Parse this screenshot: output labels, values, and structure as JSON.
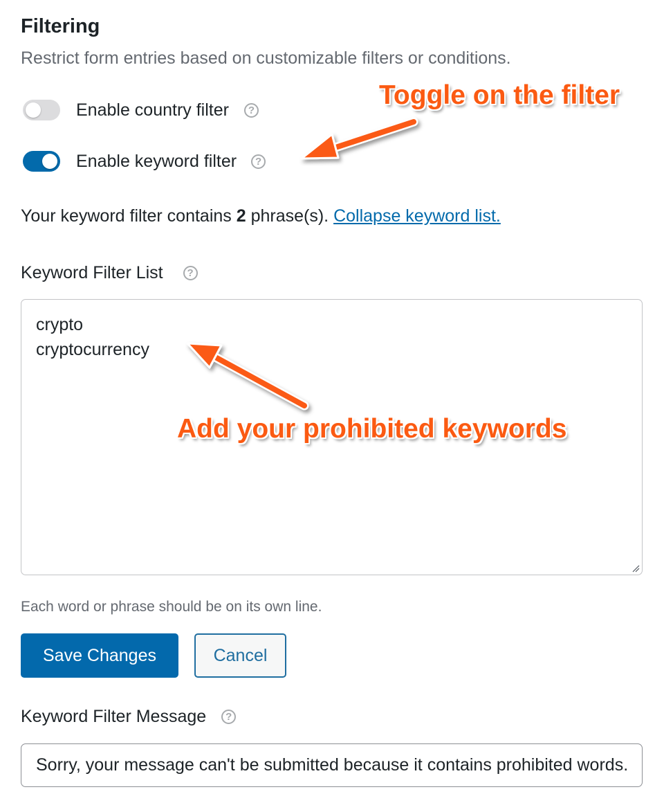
{
  "section": {
    "title": "Filtering",
    "description": "Restrict form entries based on customizable filters or conditions."
  },
  "toggles": [
    {
      "label": "Enable country filter",
      "enabled": false
    },
    {
      "label": "Enable keyword filter",
      "enabled": true
    }
  ],
  "help_icon_glyph": "?",
  "keyword_summary": {
    "prefix": "Your keyword filter contains ",
    "count": "2",
    "suffix": " phrase(s). ",
    "link_text": "Collapse keyword list."
  },
  "keyword_list": {
    "label": "Keyword Filter List",
    "lines": [
      "crypto",
      "cryptocurrency"
    ],
    "hint": "Each word or phrase should be on its own line."
  },
  "buttons": {
    "save": "Save Changes",
    "cancel": "Cancel"
  },
  "message": {
    "label": "Keyword Filter Message",
    "value": "Sorry, your message can't be submitted because it contains prohibited words."
  },
  "annotations": {
    "toggle_callout": "Toggle on the filter",
    "keywords_callout": "Add your prohibited keywords"
  },
  "colors": {
    "primary": "#0369ac",
    "link": "#036aab",
    "annotation": "#fb5a12"
  }
}
